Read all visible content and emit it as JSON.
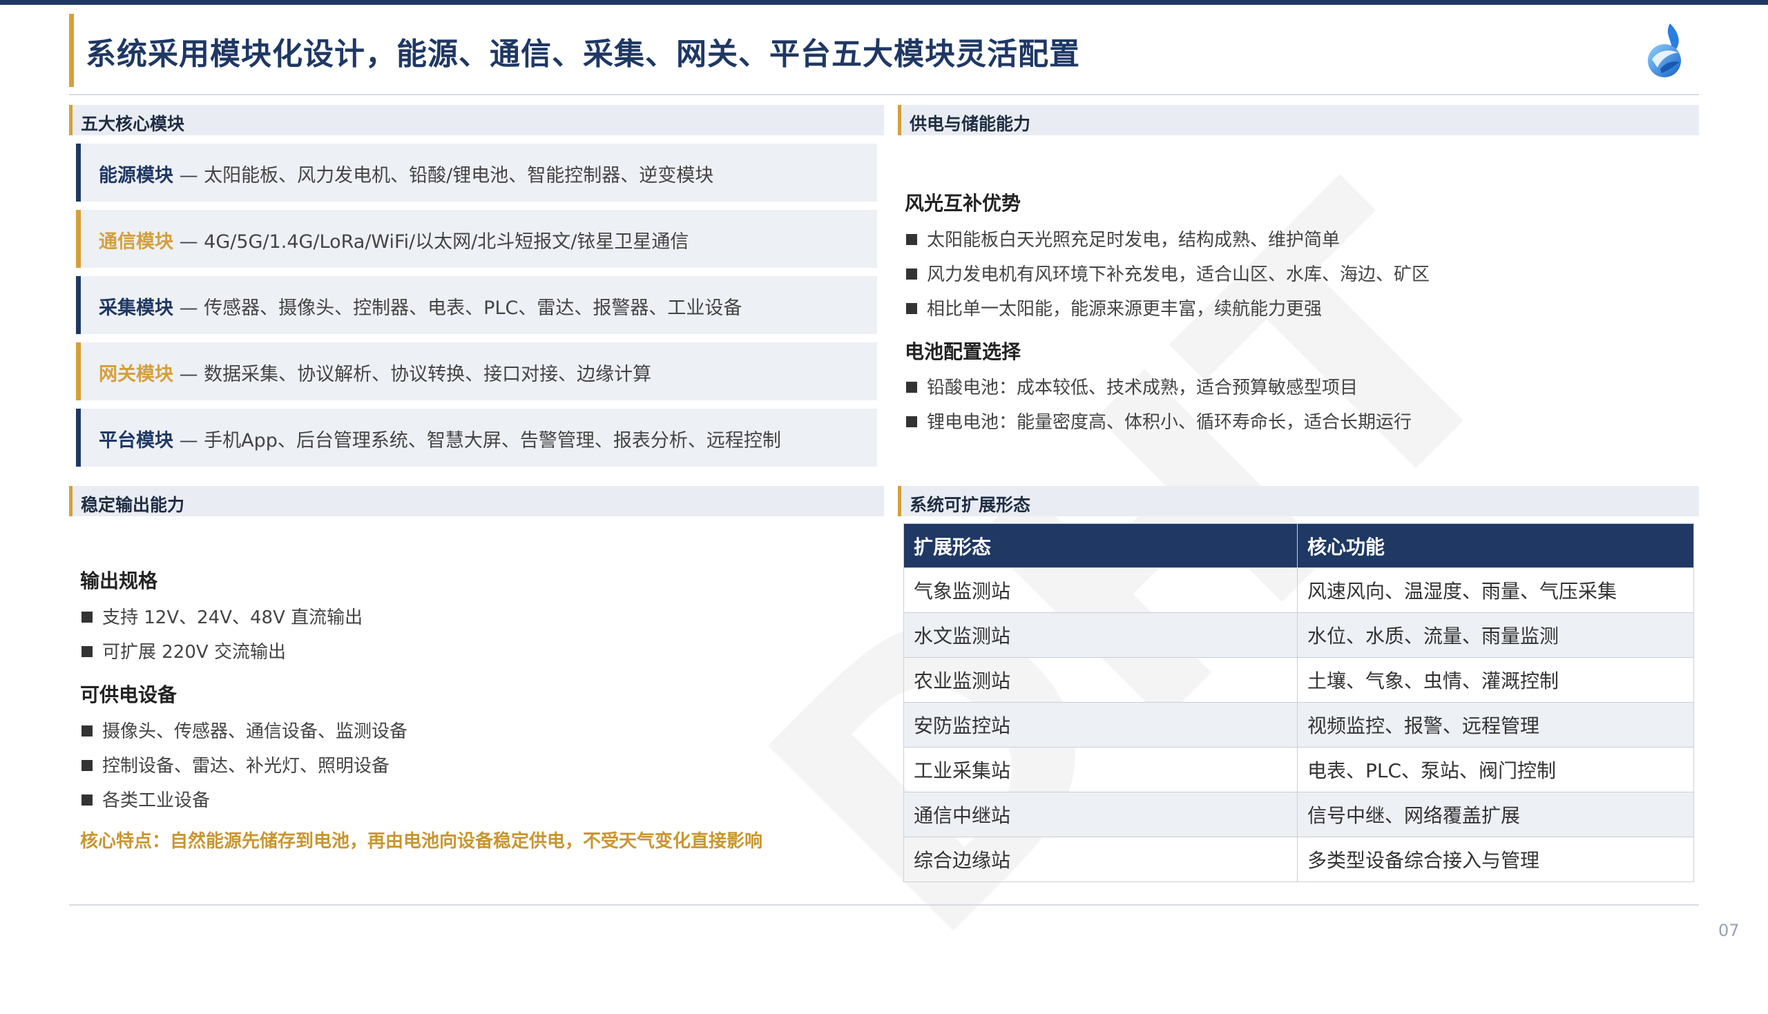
{
  "title": "系统采用模块化设计，能源、通信、采集、网关、平台五大模块灵活配置",
  "brand_color": "#1f3864",
  "accent_color": "#d4a03a",
  "logo_icon": "blue-flame-logo-icon",
  "core_modules": {
    "heading": "五大核心模块",
    "items": [
      {
        "name": "能源模块",
        "desc": " — 太阳能板、风力发电机、铅酸/锂电池、智能控制器、逆变模块"
      },
      {
        "name": "通信模块",
        "desc": " — 4G/5G/1.4G/LoRa/WiFi/以太网/北斗短报文/铱星卫星通信"
      },
      {
        "name": "采集模块",
        "desc": " — 传感器、摄像头、控制器、电表、PLC、雷达、报警器、工业设备"
      },
      {
        "name": "网关模块",
        "desc": " — 数据采集、协议解析、协议转换、接口对接、边缘计算"
      },
      {
        "name": "平台模块",
        "desc": " — 手机App、后台管理系统、智慧大屏、告警管理、报表分析、远程控制"
      }
    ]
  },
  "power_storage": {
    "heading": "供电与储能能力",
    "wind_solar": {
      "title": "风光互补优势",
      "bullets": [
        "太阳能板白天光照充足时发电，结构成熟、维护简单",
        "风力发电机有风环境下补充发电，适合山区、水库、海边、矿区",
        "相比单一太阳能，能源来源更丰富，续航能力更强"
      ]
    },
    "battery": {
      "title": "电池配置选择",
      "bullets": [
        "铅酸电池：成本较低、技术成熟，适合预算敏感型项目",
        "锂电电池：能量密度高、体积小、循环寿命长，适合长期运行"
      ]
    }
  },
  "stable_output": {
    "heading": "稳定输出能力",
    "spec": {
      "title": "输出规格",
      "bullets": [
        "支持 12V、24V、48V 直流输出",
        "可扩展 220V 交流输出"
      ]
    },
    "devices": {
      "title": "可供电设备",
      "bullets": [
        "摄像头、传感器、通信设备、监测设备",
        "控制设备、雷达、补光灯、照明设备",
        "各类工业设备"
      ]
    },
    "key_note": "核心特点：自然能源先储存到电池，再由电池向设备稳定供电，不受天气变化直接影响"
  },
  "extension": {
    "heading": "系统可扩展形态",
    "columns": [
      "扩展形态",
      "核心功能"
    ],
    "rows": [
      [
        "气象监测站",
        "风速风向、温湿度、雨量、气压采集"
      ],
      [
        "水文监测站",
        "水位、水质、流量、雨量监测"
      ],
      [
        "农业监测站",
        "土壤、气象、虫情、灌溉控制"
      ],
      [
        "安防监控站",
        "视频监控、报警、远程管理"
      ],
      [
        "工业采集站",
        "电表、PLC、泵站、阀门控制"
      ],
      [
        "通信中继站",
        "信号中继、网络覆盖扩展"
      ],
      [
        "综合边缘站",
        "多类型设备综合接入与管理"
      ]
    ]
  },
  "watermark": "DHT",
  "page_number": "07"
}
